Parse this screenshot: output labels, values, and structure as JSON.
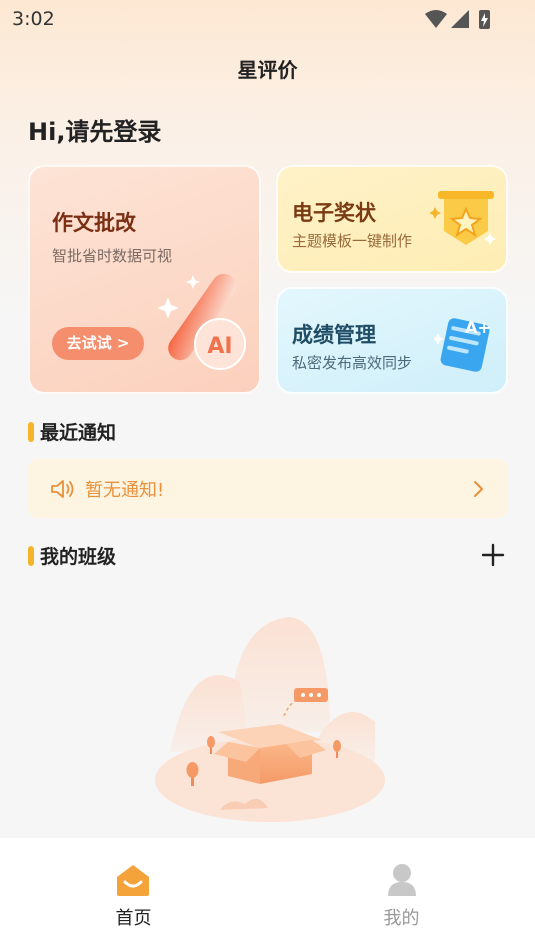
{
  "status_bar": {
    "time": "3:02"
  },
  "header": {
    "title": "星评价"
  },
  "greeting": "Hi,请先登录",
  "cards": {
    "ai": {
      "title": "作文批改",
      "subtitle": "智批省时数据可视",
      "button": "去试试 >",
      "badge": "AI"
    },
    "award": {
      "title": "电子奖状",
      "subtitle": "主题模板一键制作"
    },
    "grade": {
      "title": "成绩管理",
      "subtitle": "私密发布高效同步",
      "badge": "A+"
    }
  },
  "notices": {
    "section_title": "最近通知",
    "empty_text": "暂无通知!"
  },
  "classes": {
    "section_title": "我的班级"
  },
  "tabbar": {
    "home_label": "首页",
    "mine_label": "我的",
    "active_color": "#f4a23a",
    "inactive_color": "#999999"
  },
  "colors": {
    "accent": "#f5b52b",
    "notice_text": "#e9913a",
    "try_button": "#f48e6c"
  }
}
